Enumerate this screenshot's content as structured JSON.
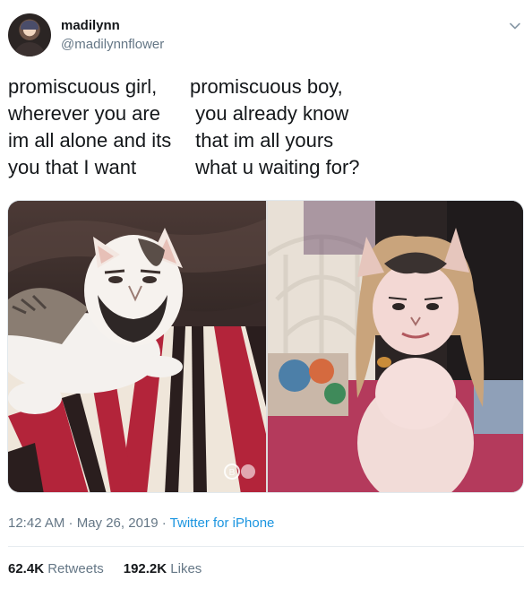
{
  "tweet": {
    "author": {
      "name": "madilynn",
      "handle": "@madilynnflower",
      "avatar_icon": "user-avatar"
    },
    "menu_icon": "chevron-down-icon",
    "text_left": "promiscuous girl,\nwherever you are\nim all alone and its\nyou that I want",
    "text_right": "promiscuous boy,\n you already know\n that im all yours\n what u waiting for?",
    "media": [
      {
        "description_icon": "cat-with-beard-photo"
      },
      {
        "description_icon": "cat-with-wig-photo"
      }
    ],
    "watermark_icon": "app-watermark-icon",
    "timestamp": "12:42 AM · May 26, 2019 · ",
    "source": "Twitter for iPhone",
    "retweets_count": "62.4K",
    "retweets_label": "Retweets",
    "likes_count": "192.2K",
    "likes_label": "Likes",
    "colors": {
      "text": "#14171a",
      "secondary": "#657786",
      "link": "#1b95e0",
      "divider": "#e6ecf0"
    }
  }
}
